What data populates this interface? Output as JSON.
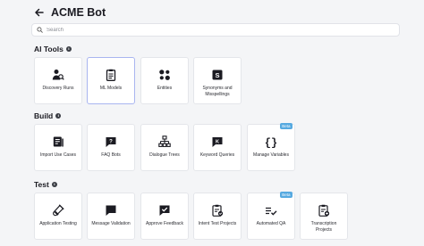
{
  "header": {
    "title": "ACME Bot"
  },
  "search": {
    "placeholder": "Search"
  },
  "sections": [
    {
      "title": "AI Tools",
      "cards": [
        {
          "label": "Discovery Runs",
          "icon": "discovery-icon"
        },
        {
          "label": "ML Models",
          "icon": "clipboard-icon"
        },
        {
          "label": "Entities",
          "icon": "entities-icon"
        },
        {
          "label": "Synonyms and Misspellings",
          "icon": "synonyms-icon"
        }
      ]
    },
    {
      "title": "Build",
      "cards": [
        {
          "label": "Import Use Cases",
          "icon": "import-icon"
        },
        {
          "label": "FAQ Bots",
          "icon": "faq-bot-icon"
        },
        {
          "label": "Dialogue Trees",
          "icon": "tree-icon"
        },
        {
          "label": "Keyword Queries",
          "icon": "keyword-icon"
        },
        {
          "label": "Manage Variables",
          "icon": "braces-icon",
          "badge": "Beta"
        }
      ]
    },
    {
      "title": "Test",
      "cards": [
        {
          "label": "Application Testing",
          "icon": "test-tube-icon"
        },
        {
          "label": "Message Validation",
          "icon": "message-icon"
        },
        {
          "label": "Approve Feedback",
          "icon": "approve-icon"
        },
        {
          "label": "Intent Test Projects",
          "icon": "intent-test-icon"
        },
        {
          "label": "Automated QA",
          "icon": "automated-qa-icon",
          "badge": "Beta"
        },
        {
          "label": "Transcription Projects",
          "icon": "transcription-icon"
        }
      ]
    }
  ],
  "colors": {
    "selected_border": "#a9b5f0",
    "badge": "#56a9e0",
    "background": "#f4f5f7"
  }
}
